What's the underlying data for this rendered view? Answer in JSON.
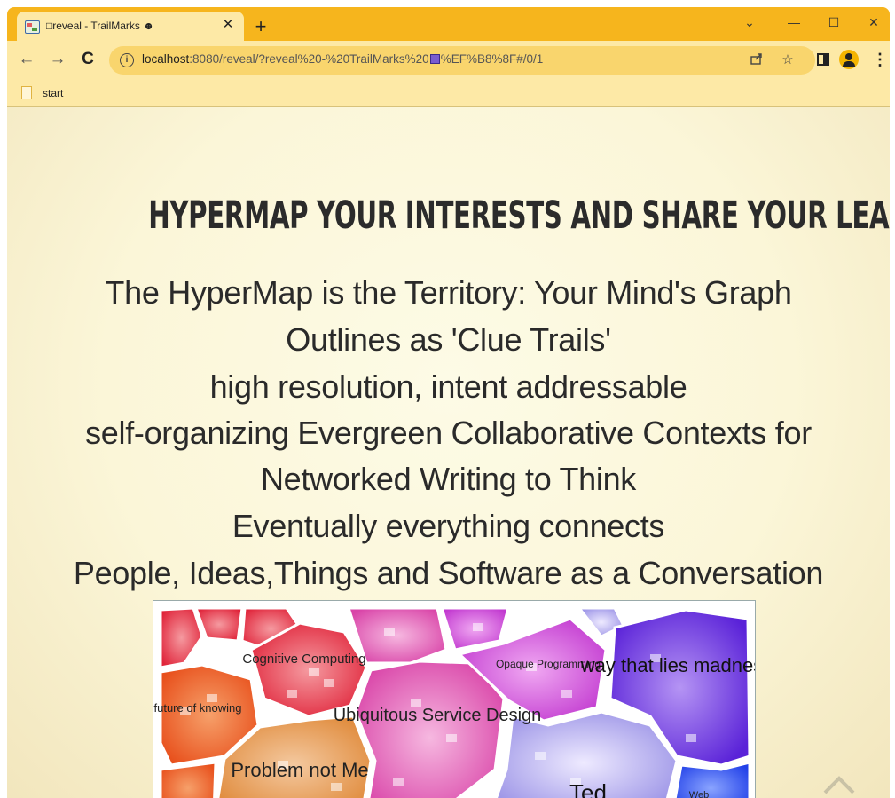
{
  "browser": {
    "tab_title": "□reveal - TrailMarks ☻",
    "tab_close": "✕",
    "new_tab": "+",
    "window_controls": {
      "chevron": "⌄",
      "minimize": "—",
      "maximize": "☐",
      "close": "✕"
    },
    "nav": {
      "back": "←",
      "forward": "→",
      "reload": "C"
    },
    "url_host": "localhost",
    "url_rest_a": ":8080/reveal/?reveal%20-%20TrailMarks%20",
    "url_rest_b": "%EF%B8%8F#/0/1",
    "info_icon": "i",
    "share_icon": "share-icon",
    "star_icon": "☆",
    "menu_icon": "⋮",
    "bookmarks": [
      {
        "label": "start"
      }
    ]
  },
  "slide": {
    "headline": "HYPERMAP YOUR INTERESTS  AND SHARE YOUR LEARNING",
    "lines": [
      "The HyperMap is the Territory: Your Mind's Graph",
      "Outlines as 'Clue Trails'",
      "high resolution, intent addressable",
      "self-organizing Evergreen Collaborative Contexts for",
      "Networked Writing to Think",
      "Eventually everything connects",
      "People, Ideas,Things and Software as a Conversation"
    ],
    "map_labels": [
      "Cognitive Computing",
      "Opaque Programming",
      "way that lies madness",
      "future of knowing",
      "Ubiquitous Service Design",
      "Problem not Me",
      "Ted",
      "Web"
    ],
    "accent_colors": {
      "chrome": "#f6b51d",
      "toolbar": "#fde9a6",
      "omnibox": "#f9d56d"
    }
  }
}
